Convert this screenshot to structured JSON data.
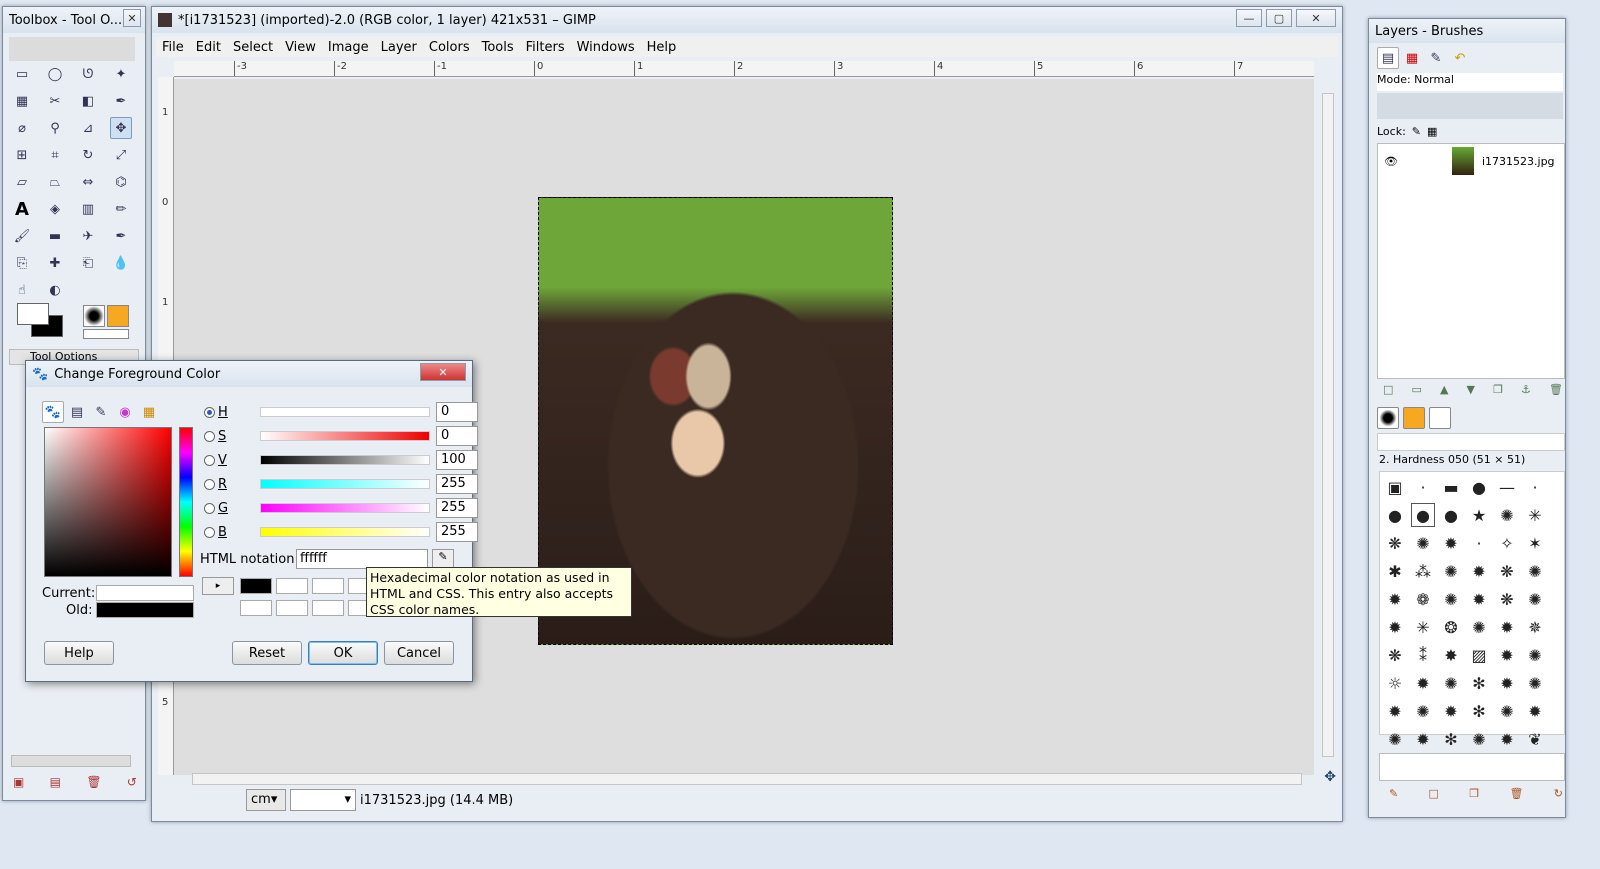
{
  "toolbox": {
    "title": "Toolbox - Tool O...",
    "tool_options_label": "Tool Options",
    "tools": [
      "rect-select",
      "ellipse-select",
      "free-select",
      "fuzzy-select",
      "color-select",
      "scissors",
      "foreground-select",
      "paths",
      "color-picker",
      "zoom",
      "measure",
      "move",
      "align",
      "crop",
      "rotate",
      "scale",
      "shear",
      "perspective",
      "flip",
      "cage",
      "text",
      "bucket-fill",
      "blend",
      "pencil",
      "paintbrush",
      "eraser",
      "airbrush",
      "ink",
      "clone",
      "heal",
      "perspective-clone",
      "blur",
      "smudge",
      "dodge-burn"
    ]
  },
  "image_window": {
    "title": "*[i1731523] (imported)-2.0 (RGB color, 1 layer) 421x531 – GIMP",
    "menu": [
      "File",
      "Edit",
      "Select",
      "View",
      "Image",
      "Layer",
      "Colors",
      "Tools",
      "Filters",
      "Windows",
      "Help"
    ],
    "ruler_labels": [
      "-3",
      "-2",
      "-1",
      "0",
      "1",
      "2",
      "3",
      "4",
      "5",
      "6",
      "7"
    ],
    "vruler_labels": [
      "1",
      "0",
      "1",
      "5"
    ],
    "unit": "cm",
    "status": "i1731523.jpg (14.4 MB)"
  },
  "layers": {
    "title": "Layers - Brushes",
    "mode_label": "Mode: Normal",
    "lock_label": "Lock:",
    "layer_name": "i1731523.jpg",
    "brush_label": "2. Hardness 050 (51 × 51)"
  },
  "dialog": {
    "title": "Change Foreground Color",
    "channels": [
      {
        "label": "H",
        "value": "0",
        "gradient": "linear-gradient(90deg,#fff,#fff)"
      },
      {
        "label": "S",
        "value": "0",
        "gradient": "linear-gradient(90deg,#fff,#e00)"
      },
      {
        "label": "V",
        "value": "100",
        "gradient": "linear-gradient(90deg,#000,#fff)"
      },
      {
        "label": "R",
        "value": "255",
        "gradient": "linear-gradient(90deg,#0ff,#fff)"
      },
      {
        "label": "G",
        "value": "255",
        "gradient": "linear-gradient(90deg,#f0f,#fff)"
      },
      {
        "label": "B",
        "value": "255",
        "gradient": "linear-gradient(90deg,#ff0,#fff)"
      }
    ],
    "html_notation_label": "HTML notation:",
    "html_value": "ffffff",
    "current_label": "Current:",
    "old_label": "Old:",
    "current_color": "#ffffff",
    "old_color": "#000000",
    "help": "Help",
    "reset": "Reset",
    "ok": "OK",
    "cancel": "Cancel"
  },
  "tooltip": "Hexadecimal color notation as used in HTML and CSS.  This entry also accepts CSS color names."
}
